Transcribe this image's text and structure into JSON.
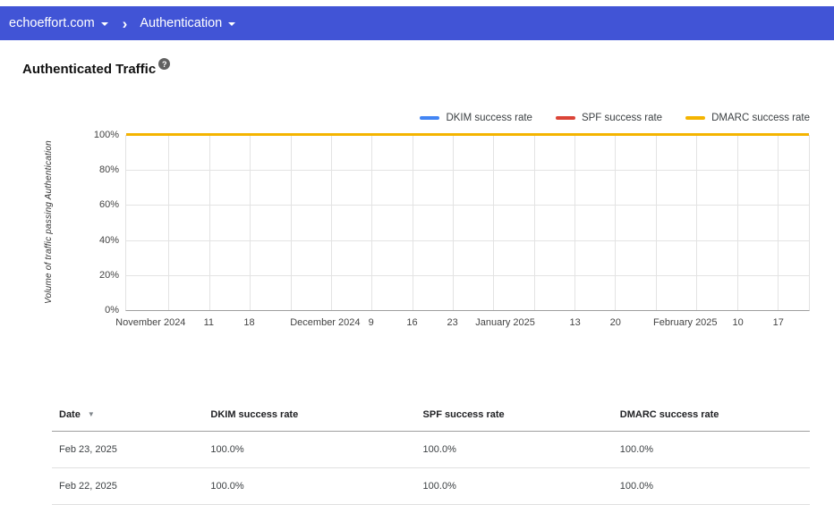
{
  "header": {
    "bar_color": "#4154d6",
    "domain_label": "echoeffort.com",
    "separator": "›",
    "section_label": "Authentication"
  },
  "page": {
    "title": "Authenticated Traffic",
    "help_icon": "?"
  },
  "chart_data": {
    "type": "line",
    "title": "Authenticated Traffic",
    "ylabel": "Volume of traffic passing Authentication",
    "xlabel": "",
    "ylim": [
      0,
      100
    ],
    "grid": true,
    "legend_position": "top-right",
    "y_ticks": [
      "0%",
      "20%",
      "40%",
      "60%",
      "80%",
      "100%"
    ],
    "x_ticks": [
      {
        "label": "November 2024",
        "pos_pct": 3.7
      },
      {
        "label": "11",
        "pos_pct": 12.2
      },
      {
        "label": "18",
        "pos_pct": 18.1
      },
      {
        "label": "December 2024",
        "pos_pct": 29.2
      },
      {
        "label": "9",
        "pos_pct": 35.9
      },
      {
        "label": "16",
        "pos_pct": 41.9
      },
      {
        "label": "23",
        "pos_pct": 47.8
      },
      {
        "label": "January 2025",
        "pos_pct": 55.5
      },
      {
        "label": "13",
        "pos_pct": 65.7
      },
      {
        "label": "20",
        "pos_pct": 71.6
      },
      {
        "label": "February 2025",
        "pos_pct": 81.8
      },
      {
        "label": "10",
        "pos_pct": 89.5
      },
      {
        "label": "17",
        "pos_pct": 95.4
      }
    ],
    "v_gridlines_pct": [
      6.2,
      12.2,
      18.1,
      24.1,
      30.0,
      35.9,
      41.9,
      47.8,
      53.8,
      59.7,
      65.7,
      71.6,
      77.6,
      83.5,
      89.5,
      95.4
    ],
    "series": [
      {
        "id": "dkim",
        "name": "DKIM success rate",
        "color": "#4285f4",
        "value_percent": 100
      },
      {
        "id": "spf",
        "name": "SPF success rate",
        "color": "#db4437",
        "value_percent": 100
      },
      {
        "id": "dmarc",
        "name": "DMARC success rate",
        "color": "#f4b400",
        "value_percent": 100
      }
    ]
  },
  "table": {
    "columns": [
      "Date",
      "DKIM success rate",
      "SPF success rate",
      "DMARC success rate"
    ],
    "sort_icon": "▼",
    "rows": [
      [
        "Feb 23, 2025",
        "100.0%",
        "100.0%",
        "100.0%"
      ],
      [
        "Feb 22, 2025",
        "100.0%",
        "100.0%",
        "100.0%"
      ]
    ]
  }
}
